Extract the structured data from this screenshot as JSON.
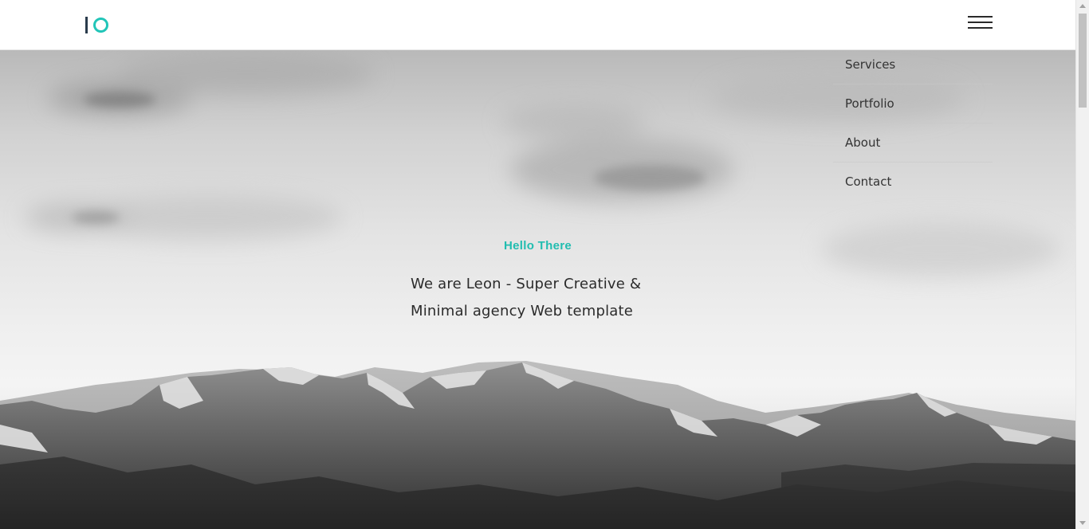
{
  "header": {
    "logo_icon": "io-logo-icon",
    "menu_icon": "hamburger-menu-icon"
  },
  "hero": {
    "eyebrow": "Hello There",
    "title_line1": "We are Leon - Super Creative &",
    "title_line2": "Minimal agency Web template"
  },
  "nav": {
    "items": [
      {
        "label": "Services"
      },
      {
        "label": "Portfolio"
      },
      {
        "label": "About"
      },
      {
        "label": "Contact"
      }
    ]
  },
  "colors": {
    "accent": "#21c5b8",
    "logo_dark": "#2a3b4c",
    "text": "#2b2b2b"
  }
}
